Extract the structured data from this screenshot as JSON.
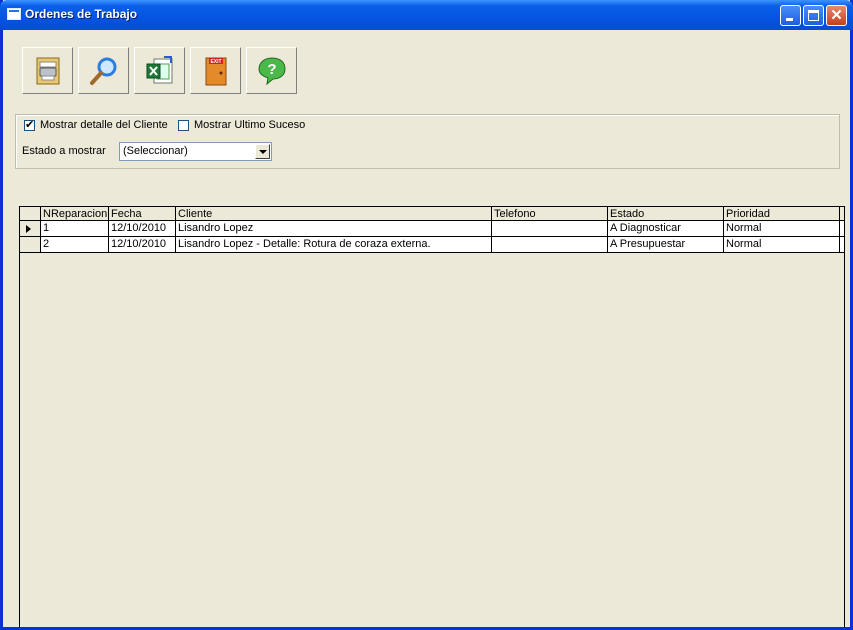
{
  "window": {
    "title": "Ordenes de Trabajo"
  },
  "titlebar_buttons": {
    "minimize": "minimize-icon",
    "maximize": "maximize-icon",
    "close": "close-icon",
    "close_glyph": "✕"
  },
  "toolbar": {
    "buttons": [
      {
        "icon": "print-icon"
      },
      {
        "icon": "search-icon"
      },
      {
        "icon": "excel-export-icon"
      },
      {
        "icon": "exit-door-icon",
        "icon_text": "EXIT"
      },
      {
        "icon": "help-icon",
        "icon_text": "?"
      }
    ]
  },
  "filters": {
    "show_client_detail": {
      "label": "Mostrar detalle del Cliente",
      "checked": true,
      "check_glyph": "✔"
    },
    "show_last_event": {
      "label": "Mostrar Ultimo Suceso",
      "checked": false
    },
    "state_label": "Estado a mostrar",
    "state_select": {
      "value": "(Seleccionar)"
    }
  },
  "grid": {
    "columns": [
      "NReparacion",
      "Fecha",
      "Cliente",
      "Telefono",
      "Estado",
      "Prioridad"
    ],
    "rows": [
      {
        "nreparacion": "1",
        "fecha": "12/10/2010",
        "cliente": "Lisandro Lopez",
        "telefono": "",
        "estado": "A Diagnosticar",
        "prioridad": "Normal",
        "current": true
      },
      {
        "nreparacion": "2",
        "fecha": "12/10/2010",
        "cliente": "Lisandro Lopez - Detalle: Rotura de coraza externa.",
        "telefono": "",
        "estado": "A Presupuestar",
        "prioridad": "Normal",
        "current": false
      }
    ]
  }
}
